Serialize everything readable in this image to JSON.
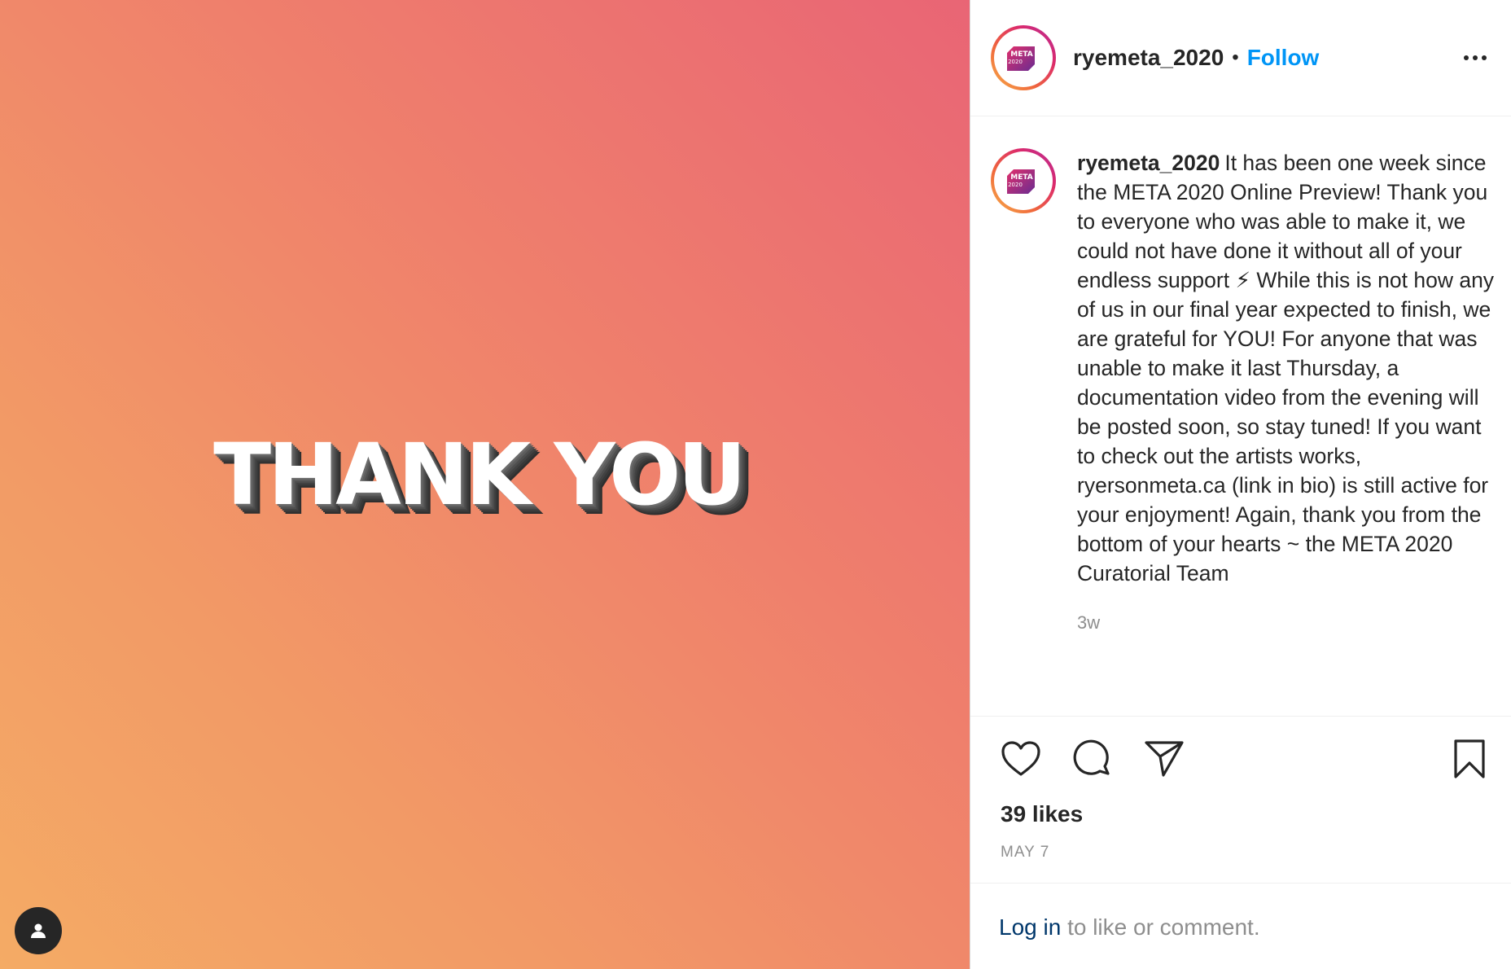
{
  "media": {
    "headline": "THANK YOU",
    "gradient_colors": [
      "#e96575",
      "#ef7f6c",
      "#f29a66",
      "#f4ab65"
    ],
    "user_tag_icon": "person-icon"
  },
  "header": {
    "username": "ryemeta_2020",
    "separator": "•",
    "follow_label": "Follow",
    "more_icon": "more-horizontal-icon"
  },
  "avatar": {
    "logo_text": "META",
    "logo_year": "2020"
  },
  "caption": {
    "username": "ryemeta_2020",
    "text": "It has been one week since the META 2020 Online Preview! Thank you to everyone who was able to make it, we could not have done it without all of your endless support ⚡︎ While this is not how any of us in our final year expected to finish, we are grateful for YOU! For anyone that was unable to make it last Thursday, a documentation video from the evening will be posted soon, so stay tuned! If you want to check out the artists works, ryersonmeta.ca (link in bio) is still active for your enjoyment! Again, thank you from the bottom of your hearts ~ the META 2020 Curatorial Team",
    "time": "3w"
  },
  "actions": {
    "like_icon": "heart-icon",
    "comment_icon": "comment-icon",
    "share_icon": "paper-plane-icon",
    "save_icon": "bookmark-icon"
  },
  "likes": "39 likes",
  "date": "MAY 7",
  "login": {
    "link": "Log in",
    "rest": " to like or comment."
  },
  "colors": {
    "accent": "#0095f6",
    "link_dark": "#00376b",
    "muted": "#8e8e8e",
    "text": "#262626"
  }
}
